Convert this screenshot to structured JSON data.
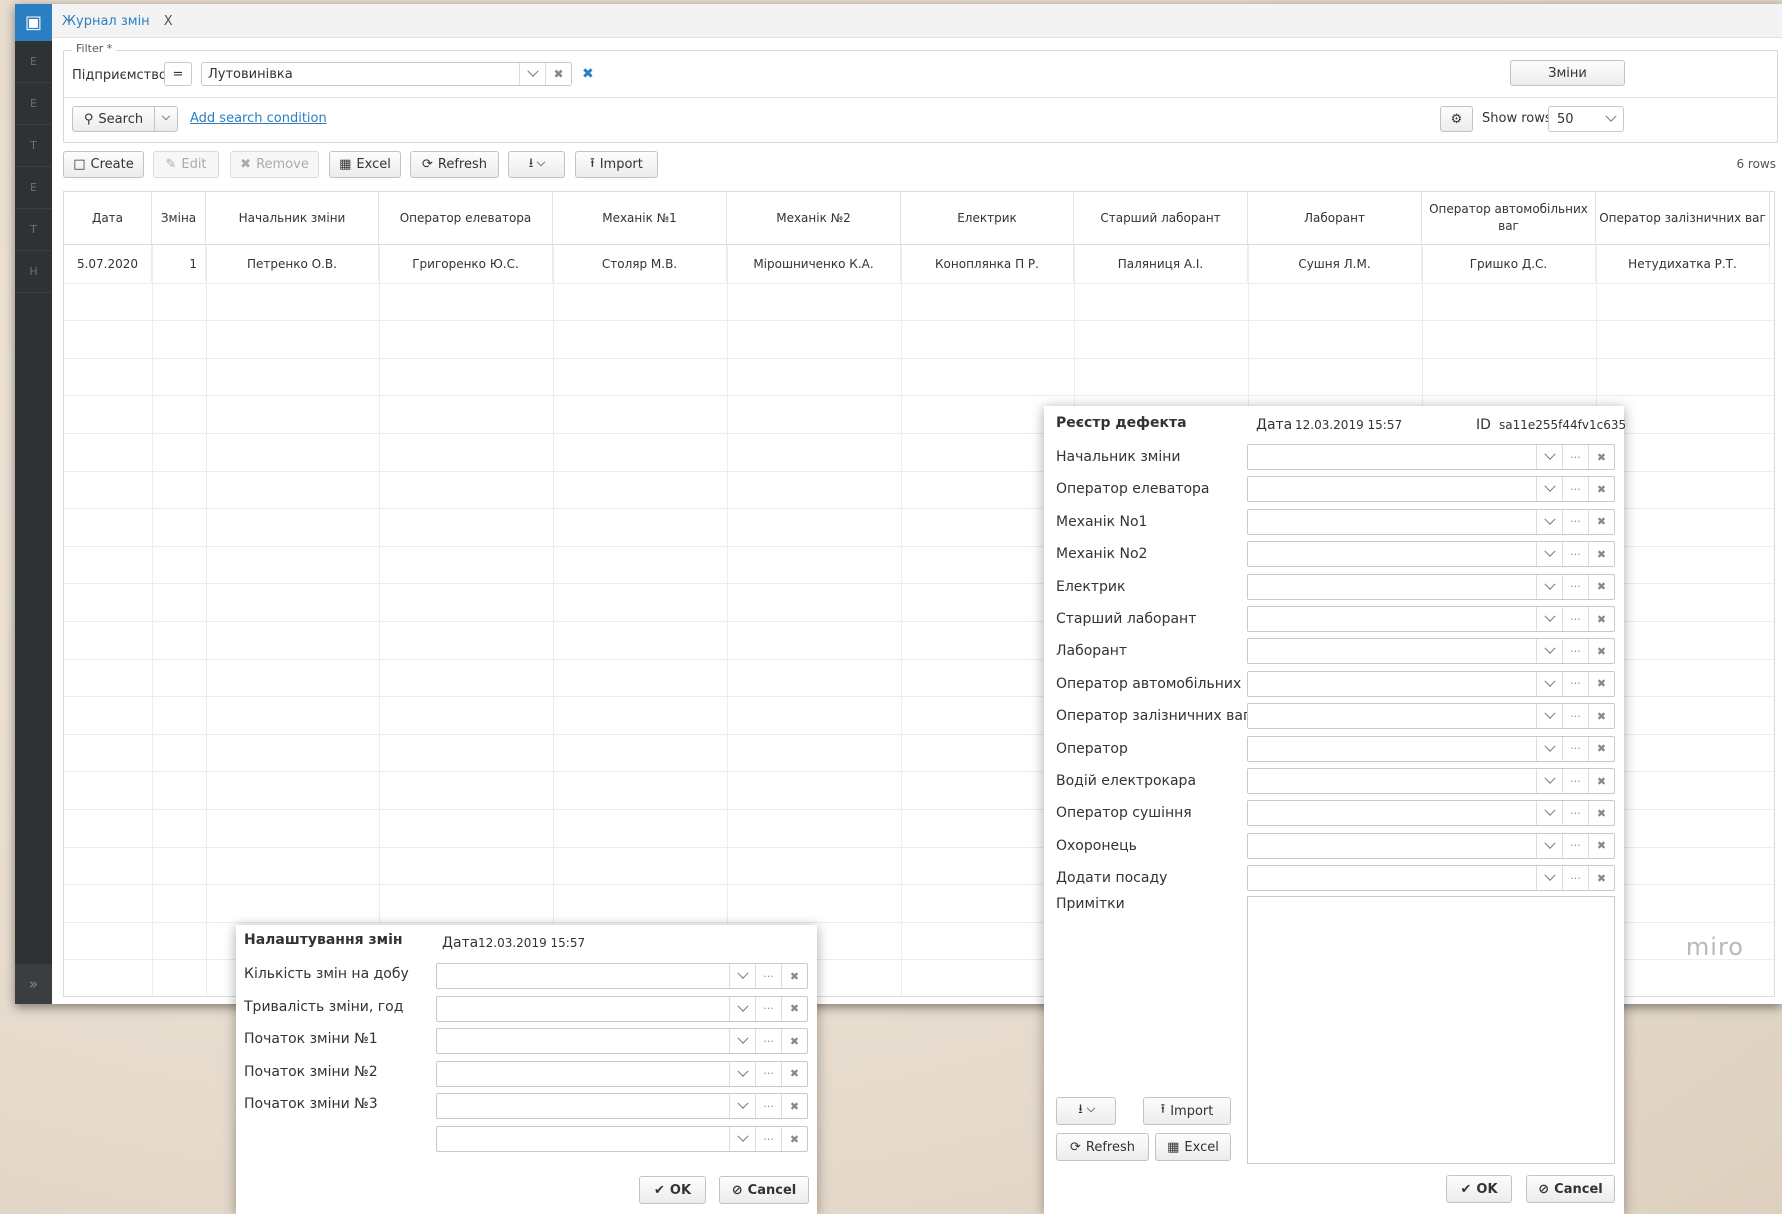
{
  "app": {
    "tab_title": "Журнал змін",
    "tab_close": "X",
    "side_letters": [
      "E",
      "E",
      "T",
      "E",
      "T",
      "H"
    ],
    "expand_icon": "»"
  },
  "filter": {
    "legend": "Filter *",
    "field_label": "Підприємство",
    "operator": "=",
    "value": "Лутовинівка",
    "changes_button": "Зміни",
    "search_button": "Search",
    "add_condition": "Add search condition",
    "show_rows_label": "Show rows",
    "show_rows_value": "50"
  },
  "toolbar": {
    "create": "Create",
    "edit": "Edit",
    "remove": "Remove",
    "excel": "Excel",
    "refresh": "Refresh",
    "import": "Import",
    "rows_count": "6 rows"
  },
  "table": {
    "columns": [
      "Дата",
      "Зміна",
      "Начальник зміни",
      "Оператор елеватора",
      "Механік №1",
      "Механік №2",
      "Електрик",
      "Старший лаборант",
      "Лаборант",
      "Оператор автомобільних ваг",
      "Оператор залізничних ваг"
    ],
    "rows": [
      [
        "5.07.2020",
        "1",
        "Петренко О.В.",
        "Григоренко Ю.С.",
        "Столяр М.В.",
        "Мірошниченко К.А.",
        "Коноплянка П Р.",
        "Паляниця А.І.",
        "Сушня Л.М.",
        "Гришко Д.С.",
        "Нетудихатка Р.Т."
      ]
    ],
    "watermark": "miro"
  },
  "defect_dialog": {
    "title": "Реєстр дефекта",
    "date_label": "Дата",
    "date_value": "12.03.2019 15:57",
    "id_label": "ID",
    "id_value": "sa11e255f44fv1c635",
    "fields": [
      "Начальник зміни",
      "Оператор елеватора",
      "Механік No1",
      "Механік No2",
      "Електрик",
      "Старший лаборант",
      "Лаборант",
      "Оператор автомобільних",
      "Оператор залізничних ваг",
      "Оператор",
      "Водій електрокара",
      "Оператор сушіння",
      "Охоронець",
      "Додати посаду"
    ],
    "notes_label": "Примітки",
    "import": "Import",
    "refresh": "Refresh",
    "excel": "Excel",
    "ok": "OK",
    "cancel": "Cancel"
  },
  "shift_dialog": {
    "title": "Налаштування змін",
    "date_label": "Дата",
    "date_value": "12.03.2019 15:57",
    "fields": [
      "Кількість змін на добу",
      "Тривалість зміни, год",
      "Початок зміни №1",
      "Початок зміни №2",
      "Початок зміни №3",
      ""
    ],
    "ok": "OK",
    "cancel": "Cancel"
  }
}
